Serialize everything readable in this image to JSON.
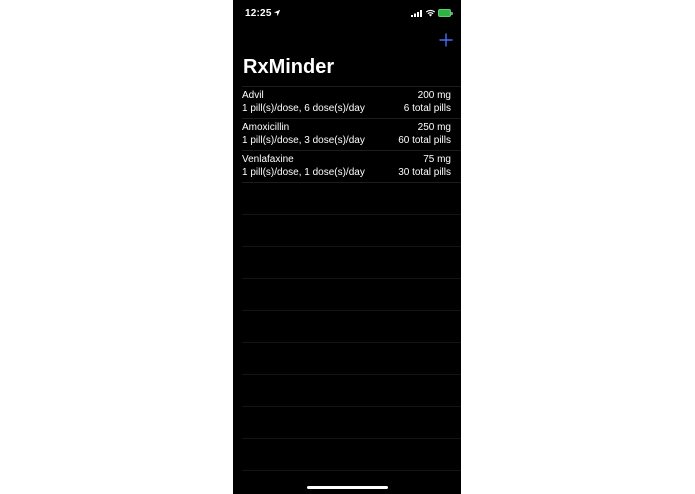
{
  "status_bar": {
    "time": "12:25",
    "battery_color": "#2fb344"
  },
  "nav": {
    "add_icon": "plus-icon",
    "accent_color": "#4a6cf7"
  },
  "title": "RxMinder",
  "medications": [
    {
      "name": "Advil",
      "dose": "200 mg",
      "schedule": "1 pill(s)/dose, 6 dose(s)/day",
      "total": "6 total pills"
    },
    {
      "name": "Amoxicillin",
      "dose": "250 mg",
      "schedule": "1 pill(s)/dose, 3 dose(s)/day",
      "total": "60 total pills"
    },
    {
      "name": "Venlafaxine",
      "dose": "75 mg",
      "schedule": "1 pill(s)/dose, 1 dose(s)/day",
      "total": "30 total pills"
    }
  ]
}
